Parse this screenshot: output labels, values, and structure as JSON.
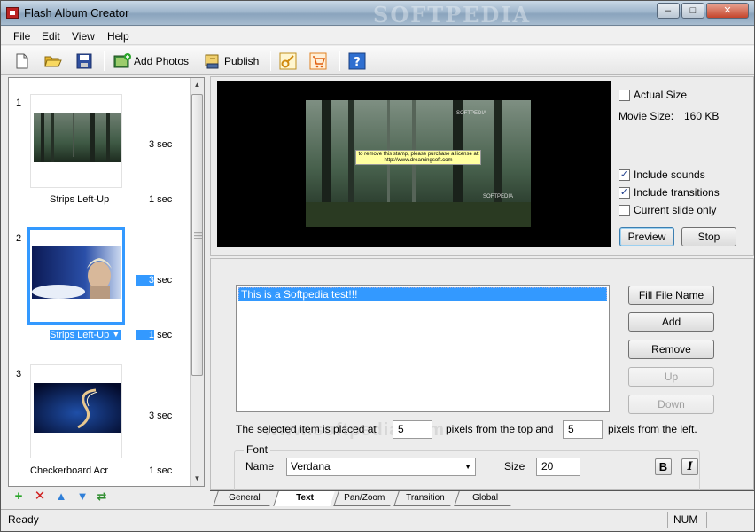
{
  "window": {
    "title": "Flash Album Creator",
    "watermark": "SOFTPEDIA"
  },
  "menu": [
    "File",
    "Edit",
    "View",
    "Help"
  ],
  "toolbar": {
    "add_photos": "Add Photos",
    "publish": "Publish"
  },
  "slides": [
    {
      "num": "1",
      "duration": "3 sec",
      "transition": "Strips Left-Up",
      "transition_time": "1 sec"
    },
    {
      "num": "2",
      "duration": "3 sec",
      "transition": "Strips Left-Up",
      "transition_time": "1 sec"
    },
    {
      "num": "3",
      "duration": "3 sec",
      "transition": "Checkerboard Acr",
      "transition_time": "1 sec"
    }
  ],
  "preview": {
    "stamp": "to remove this stamp, please purchase a license at http://www.dreamingsoft.com",
    "slide_caption_top": "SOFTPEDIA",
    "slide_caption_bottom": "SOFTPEDIA",
    "actual_size": "Actual Size",
    "movie_size_label": "Movie Size:",
    "movie_size_value": "160 KB",
    "include_sounds": "Include sounds",
    "include_transitions": "Include transitions",
    "current_slide_only": "Current slide only",
    "preview_btn": "Preview",
    "stop_btn": "Stop"
  },
  "text_editor": {
    "items": [
      "This is a Softpedia test!!!"
    ],
    "fill_file_name": "Fill File Name",
    "add": "Add",
    "remove": "Remove",
    "up": "Up",
    "down": "Down",
    "placement_prefix": "The selected item is placed at",
    "top_value": "5",
    "placement_middle": "pixels from the top and",
    "left_value": "5",
    "placement_suffix": "pixels from the left.",
    "watermark": "www.softpedia.com",
    "font_group": "Font",
    "name_label": "Name",
    "font_name": "Verdana",
    "size_label": "Size",
    "font_size": "20",
    "bold": "B",
    "italic": "I"
  },
  "tabs": [
    "General",
    "Text",
    "Pan/Zoom",
    "Transition",
    "Global"
  ],
  "status": {
    "text": "Ready",
    "num": "NUM"
  },
  "colors": {
    "accent": "#3399ff",
    "titlebar": "#9fb6cc"
  }
}
